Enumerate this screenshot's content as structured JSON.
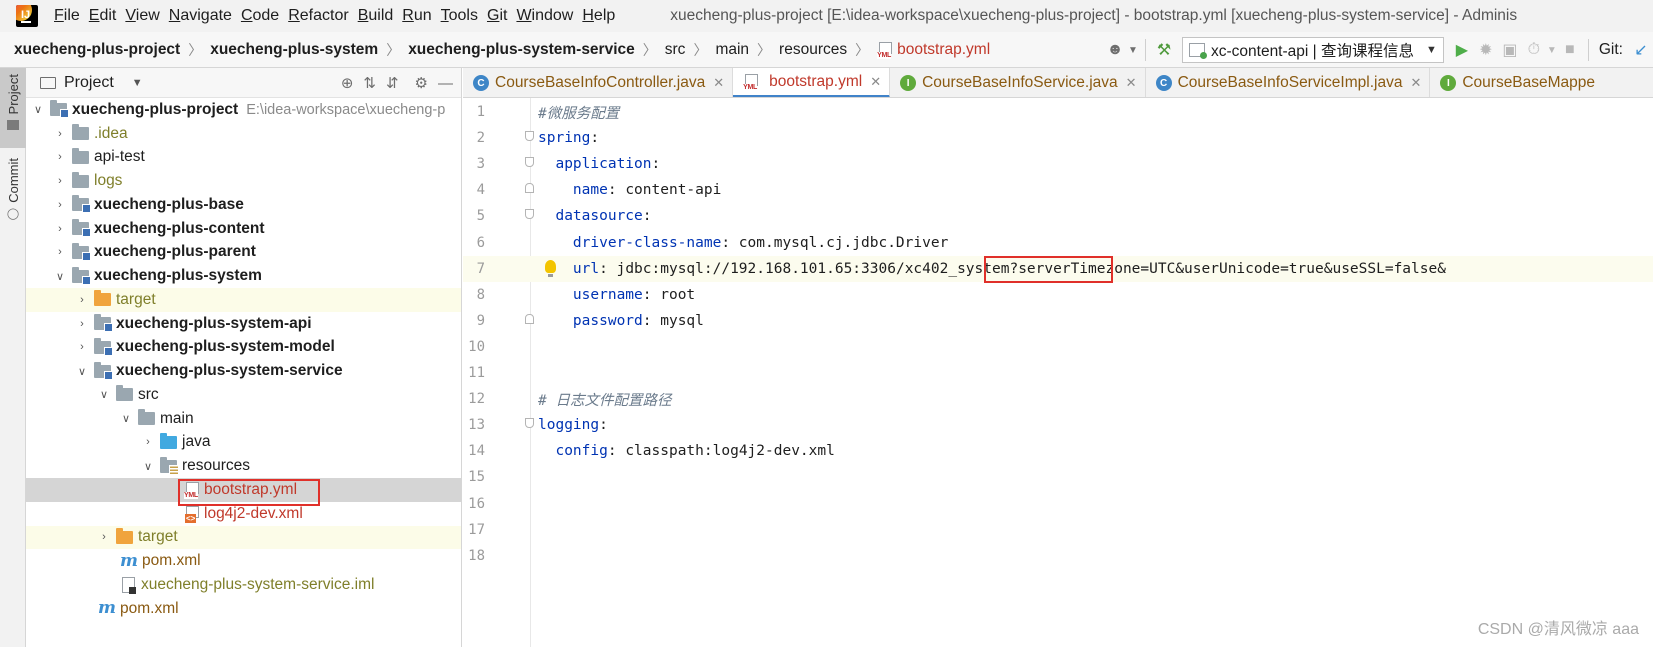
{
  "menubar": {
    "items": [
      "File",
      "Edit",
      "View",
      "Navigate",
      "Code",
      "Refactor",
      "Build",
      "Run",
      "Tools",
      "Git",
      "Window",
      "Help"
    ],
    "window_title": "xuecheng-plus-project [E:\\idea-workspace\\xuecheng-plus-project] - bootstrap.yml [xuecheng-plus-system-service] - Adminis"
  },
  "breadcrumb": {
    "items": [
      "xuecheng-plus-project",
      "xuecheng-plus-system",
      "xuecheng-plus-system-service",
      "src",
      "main",
      "resources",
      "bootstrap.yml"
    ]
  },
  "toolbar": {
    "run_config": "xc-content-api | 查询课程信息",
    "git_label": "Git:"
  },
  "tool_strip": {
    "project": "Project",
    "commit": "Commit"
  },
  "project_panel": {
    "title": "Project",
    "root_path": "E:\\idea-workspace\\xuecheng-p",
    "nodes": [
      "xuecheng-plus-project",
      ".idea",
      "api-test",
      "logs",
      "xuecheng-plus-base",
      "xuecheng-plus-content",
      "xuecheng-plus-parent",
      "xuecheng-plus-system",
      "target",
      "xuecheng-plus-system-api",
      "xuecheng-plus-system-model",
      "xuecheng-plus-system-service",
      "src",
      "main",
      "java",
      "resources",
      "bootstrap.yml",
      "log4j2-dev.xml",
      "target",
      "pom.xml",
      "xuecheng-plus-system-service.iml",
      "pom.xml"
    ]
  },
  "tabs": [
    {
      "label": "CourseBaseInfoController.java",
      "kind": "class"
    },
    {
      "label": "bootstrap.yml",
      "kind": "yml",
      "active": true
    },
    {
      "label": "CourseBaseInfoService.java",
      "kind": "interface"
    },
    {
      "label": "CourseBaseInfoServiceImpl.java",
      "kind": "class"
    },
    {
      "label": "CourseBaseMappe",
      "kind": "interface"
    }
  ],
  "editor": {
    "line_numbers": [
      "1",
      "2",
      "3",
      "4",
      "5",
      "6",
      "7",
      "8",
      "9",
      "10",
      "11",
      "12",
      "13",
      "14",
      "15",
      "16",
      "17",
      "18"
    ],
    "lines": {
      "l1": "#微服务配置",
      "l2_key": "spring",
      "l3_key": "application",
      "l4_key": "name",
      "l4_val": "content-api",
      "l5_key": "datasource",
      "l6_key": "driver-class-name",
      "l6_val": "com.mysql.cj.jdbc.Driver",
      "l7_key": "url",
      "l7_val_a": "jdbc:mysql://192.168.101.65:3306/",
      "l7_val_b": "xc402_system?",
      "l7_val_c": "serverTimezone=UTC&userUnicode=true&useSSL=false&",
      "l8_key": "username",
      "l8_val": "root",
      "l9_key": "password",
      "l9_val": "mysql",
      "l12": "# 日志文件配置路径",
      "l13_key": "logging",
      "l14_key": "config",
      "l14_val": "classpath:log4j2-dev.xml"
    }
  },
  "watermark": "CSDN @清风微凉 aaa"
}
